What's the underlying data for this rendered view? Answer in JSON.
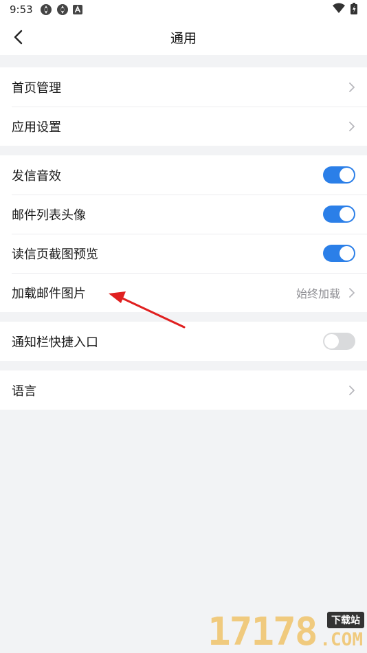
{
  "status_bar": {
    "time": "9:53",
    "icons": [
      "app-notification-icon",
      "app-notification-icon",
      "a-letter-icon"
    ],
    "right_icons": [
      "wifi-icon",
      "battery-icon"
    ]
  },
  "header": {
    "title": "通用",
    "back_icon": "back-chevron-icon"
  },
  "groups": [
    {
      "rows": [
        {
          "label": "首页管理",
          "control": "chevron"
        },
        {
          "label": "应用设置",
          "control": "chevron"
        }
      ]
    },
    {
      "rows": [
        {
          "label": "发信音效",
          "control": "toggle",
          "state": "on"
        },
        {
          "label": "邮件列表头像",
          "control": "toggle",
          "state": "on"
        },
        {
          "label": "读信页截图预览",
          "control": "toggle",
          "state": "on"
        },
        {
          "label": "加载邮件图片",
          "control": "chevron",
          "value": "始终加载"
        }
      ]
    },
    {
      "rows": [
        {
          "label": "通知栏快捷入口",
          "control": "toggle",
          "state": "off"
        }
      ]
    },
    {
      "rows": [
        {
          "label": "语言",
          "control": "chevron"
        }
      ]
    }
  ],
  "annotation": {
    "type": "red-arrow",
    "color": "#e02020",
    "points_to": "加载邮件图片"
  },
  "watermark": {
    "digits": "17178",
    "tag": "下载站",
    "suffix": ".COM"
  },
  "colors": {
    "accent": "#2b7fe8",
    "toggle_off": "#d9dadc",
    "background": "#f2f3f5"
  }
}
